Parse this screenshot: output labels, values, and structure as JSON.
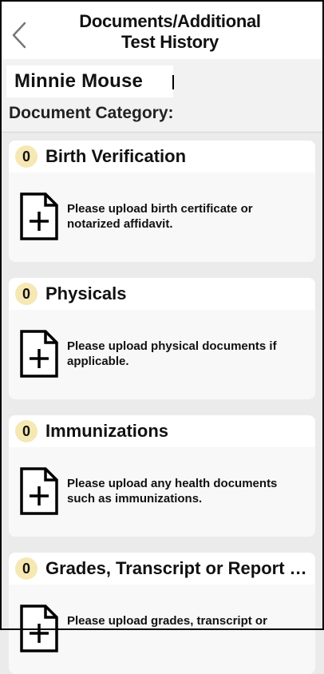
{
  "header": {
    "title_line1": "Documents/Additional",
    "title_line2": "Test History"
  },
  "student": {
    "name": "Minnie Mouse"
  },
  "category_label": "Document Category:",
  "categories": [
    {
      "count": "0",
      "title": "Birth Verification",
      "desc_line1": "Please upload birth certificate or",
      "desc_line2": "notarized affidavit."
    },
    {
      "count": "0",
      "title": "Physicals",
      "desc_line1": "Please upload physical documents if",
      "desc_line2": "applicable."
    },
    {
      "count": "0",
      "title": "Immunizations",
      "desc_line1": "Please upload any health documents",
      "desc_line2": "such as immunizations."
    },
    {
      "count": "0",
      "title": "Grades, Transcript or Report C...",
      "desc_line1": "Please upload grades, transcript or",
      "desc_line2": ""
    }
  ],
  "colors": {
    "badge": "#f6e8b3",
    "background": "#ebebeb",
    "card": "#f8f8f8"
  }
}
